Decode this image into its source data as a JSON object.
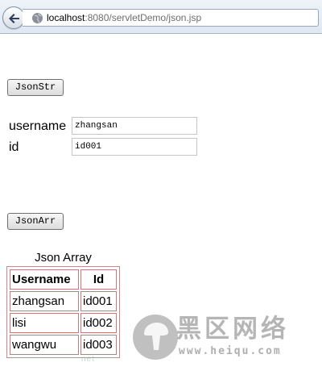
{
  "browser": {
    "url_host": "localhost",
    "url_rest": ":8080/servletDemo/json.jsp"
  },
  "buttons": {
    "json_str": "JsonStr",
    "json_arr": "JsonArr"
  },
  "form": {
    "username_label": "username",
    "username_value": "zhangsan",
    "id_label": "id",
    "id_value": "id001"
  },
  "table": {
    "caption": "Json Array",
    "headers": [
      "Username",
      "Id"
    ],
    "rows": [
      [
        "zhangsan",
        "id001"
      ],
      [
        "lisi",
        "id002"
      ],
      [
        "wangwu",
        "id003"
      ]
    ]
  },
  "watermark": {
    "title": "黑区网络",
    "url": "www.heiqu.com",
    "faint": "net"
  },
  "icons": {
    "back": "back-arrow-icon",
    "site": "globe-icon",
    "logo": "mushroom-logo-icon"
  }
}
